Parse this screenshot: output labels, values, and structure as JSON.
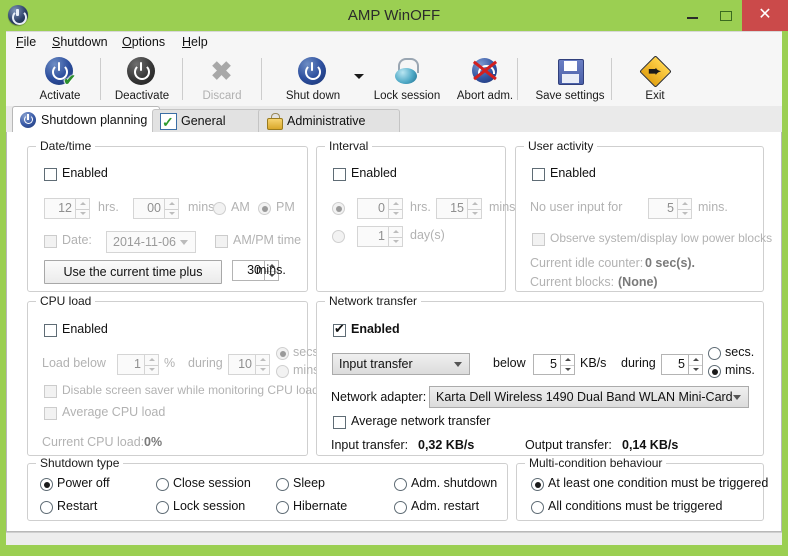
{
  "window": {
    "title": "AMP WinOFF",
    "minimize_label": "minimize",
    "maximize_label": "maximize",
    "close_label": "✕"
  },
  "menubar": {
    "items": [
      {
        "label": "File",
        "accel": "F"
      },
      {
        "label": "Shutdown",
        "accel": "S"
      },
      {
        "label": "Options",
        "accel": "O"
      },
      {
        "label": "Help",
        "accel": "H"
      }
    ]
  },
  "toolbar": {
    "buttons": [
      {
        "label": "Activate",
        "icon": "power-check-icon",
        "enabled": true
      },
      {
        "label": "Deactivate",
        "icon": "power-dark-icon",
        "enabled": true
      },
      {
        "label": "Discard",
        "icon": "discard-x-icon",
        "enabled": false
      },
      {
        "label": "Shut down",
        "icon": "power-blue-icon",
        "enabled": true
      },
      {
        "label": "Lock session",
        "icon": "padlock-icon",
        "enabled": true
      },
      {
        "label": "Abort adm.",
        "icon": "abort-network-icon",
        "enabled": true
      },
      {
        "label": "Save settings",
        "icon": "floppy-disk-icon",
        "enabled": true
      },
      {
        "label": "Exit",
        "icon": "exit-sign-icon",
        "enabled": true
      }
    ],
    "dropdown_icon": "chevron-down-icon"
  },
  "tabs": [
    {
      "label": "Shutdown planning",
      "icon": "power-icon",
      "active": true
    },
    {
      "label": "General options",
      "icon": "checkbox-icon",
      "active": false
    },
    {
      "label": "Administrative options",
      "icon": "padlock-icon",
      "active": false
    }
  ],
  "date_time": {
    "title": "Date/time",
    "enabled_label": "Enabled",
    "enabled_checked": false,
    "hours_value": "12",
    "hours_label": "hrs.",
    "minutes_value": "00",
    "minutes_label": "mins.",
    "am_label": "AM",
    "pm_label": "PM",
    "am_pm_selected": "PM",
    "date_label": "Date:",
    "date_checked": false,
    "date_value": "2014-11-06",
    "ampm_time_label": "AM/PM time",
    "ampm_time_checked": false,
    "use_current_button": "Use the current time plus",
    "plus_value": "30",
    "plus_units": "mins."
  },
  "interval": {
    "title": "Interval",
    "enabled_label": "Enabled",
    "enabled_checked": false,
    "mode_selected": "hours",
    "hours_value": "0",
    "hours_label": "hrs.",
    "minutes_value": "15",
    "minutes_label": "mins.",
    "days_value": "1",
    "days_label": "day(s)"
  },
  "user_activity": {
    "title": "User activity",
    "enabled_label": "Enabled",
    "enabled_checked": false,
    "no_input_label": "No user input for",
    "no_input_value": "5",
    "no_input_units": "mins.",
    "observe_label": "Observe system/display low power blocks",
    "observe_checked": false,
    "idle_counter_label": "Current idle counter:",
    "idle_counter_value": "0 sec(s).",
    "blocks_label": "Current blocks:",
    "blocks_value": "(None)"
  },
  "cpu_load": {
    "title": "CPU load",
    "enabled_label": "Enabled",
    "enabled_checked": false,
    "load_below_label": "Load below",
    "load_below_value": "1",
    "percent_label": "%",
    "during_label": "during",
    "during_value": "10",
    "secs_label": "secs.",
    "mins_label": "mins.",
    "unit_selected": "secs",
    "disable_saver_label": "Disable screen saver while monitoring CPU load",
    "disable_saver_checked": false,
    "average_label": "Average CPU load",
    "average_checked": false,
    "current_label": "Current CPU load:",
    "current_value": "0%"
  },
  "network": {
    "title": "Network transfer",
    "enabled_label": "Enabled",
    "enabled_checked": true,
    "transfer_type": "Input transfer",
    "below_label": "below",
    "below_value": "5",
    "below_units": "KB/s",
    "during_label": "during",
    "during_value": "5",
    "secs_label": "secs.",
    "mins_label": "mins.",
    "unit_selected": "mins",
    "adapter_label": "Network adapter:",
    "adapter_value": "Karta Dell Wireless 1490 Dual Band WLAN Mini-Card",
    "average_label": "Average network transfer",
    "average_checked": false,
    "input_transfer_label": "Input transfer:",
    "input_transfer_value": "0,32 KB/s",
    "output_transfer_label": "Output transfer:",
    "output_transfer_value": "0,14 KB/s"
  },
  "shutdown_type": {
    "title": "Shutdown type",
    "selected": "Power off",
    "options": [
      "Power off",
      "Close session",
      "Sleep",
      "Adm. shutdown",
      "Restart",
      "Lock session",
      "Hibernate",
      "Adm. restart"
    ]
  },
  "multi_condition": {
    "title": "Multi-condition behaviour",
    "selected": "At least one condition must be triggered",
    "options": [
      "At least one condition must be triggered",
      "All conditions must be triggered"
    ]
  },
  "colors": {
    "title_bar": "#9BCF52",
    "close_button": "#CB4A4A",
    "panel": "#FFFFFF",
    "toolbar": "#F6F6F6"
  }
}
